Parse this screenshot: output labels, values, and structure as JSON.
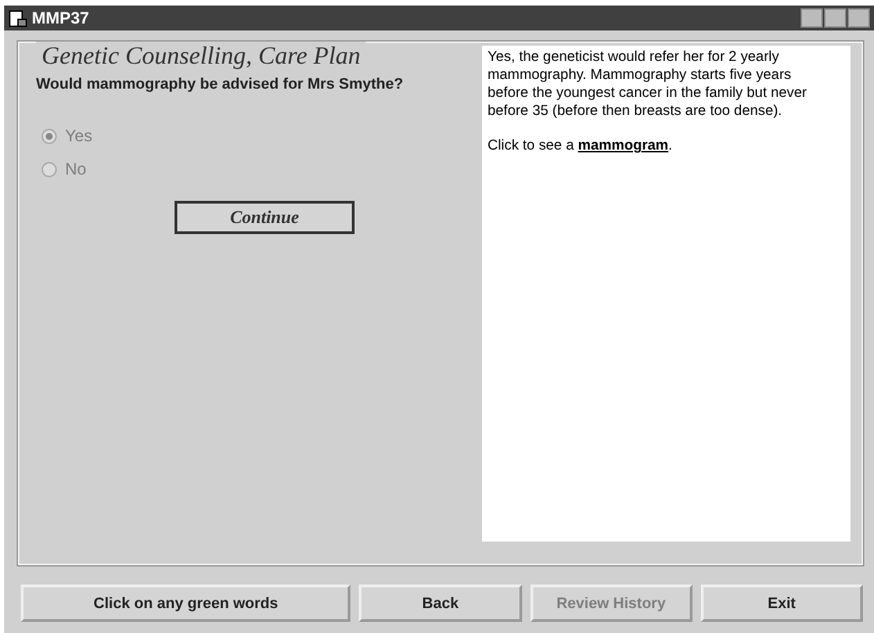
{
  "window": {
    "title": "MMP37"
  },
  "group": {
    "title": "Genetic Counselling, Care Plan"
  },
  "question": "Would mammography be advised for Mrs Smythe?",
  "options": [
    {
      "label": "Yes",
      "selected": true,
      "disabled": true
    },
    {
      "label": "No",
      "selected": false,
      "disabled": true
    }
  ],
  "continue_button": {
    "label": "Continue"
  },
  "answer": {
    "text": "Yes, the geneticist would refer her for 2 yearly mammography. Mammography starts five years before the youngest cancer in the family but never before 35 (before then breasts are too dense).",
    "link_prefix": "Click to see a",
    "link": "mammogram",
    "link_suffix": "."
  },
  "buttons": [
    {
      "label": "Click on any green words",
      "disabled": false
    },
    {
      "label": "Back",
      "disabled": false
    },
    {
      "label": "Review History",
      "disabled": true
    },
    {
      "label": "Exit",
      "disabled": false
    }
  ]
}
